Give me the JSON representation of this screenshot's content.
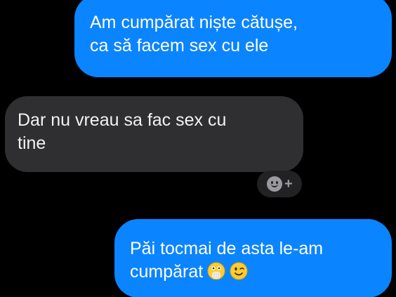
{
  "messages": [
    {
      "sender": "me",
      "lines": [
        "Am cumpărat niște cătușe,",
        "ca să facem sex cu ele"
      ]
    },
    {
      "sender": "other",
      "lines": [
        "Dar nu vreau sa fac sex cu",
        "tine"
      ]
    },
    {
      "sender": "me",
      "lines": [
        "Păi tocmai de asta le-am",
        "cumpărat"
      ],
      "emojis": [
        "hand-over-mouth-emoji",
        "winking-face-emoji"
      ]
    }
  ],
  "reaction_button": {
    "icon": "smiley-plus-icon",
    "label": "+"
  },
  "colors": {
    "background": "#000000",
    "sent_bubble": "#0b84ff",
    "received_bubble": "#2f2f31",
    "text": "#ffffff"
  }
}
